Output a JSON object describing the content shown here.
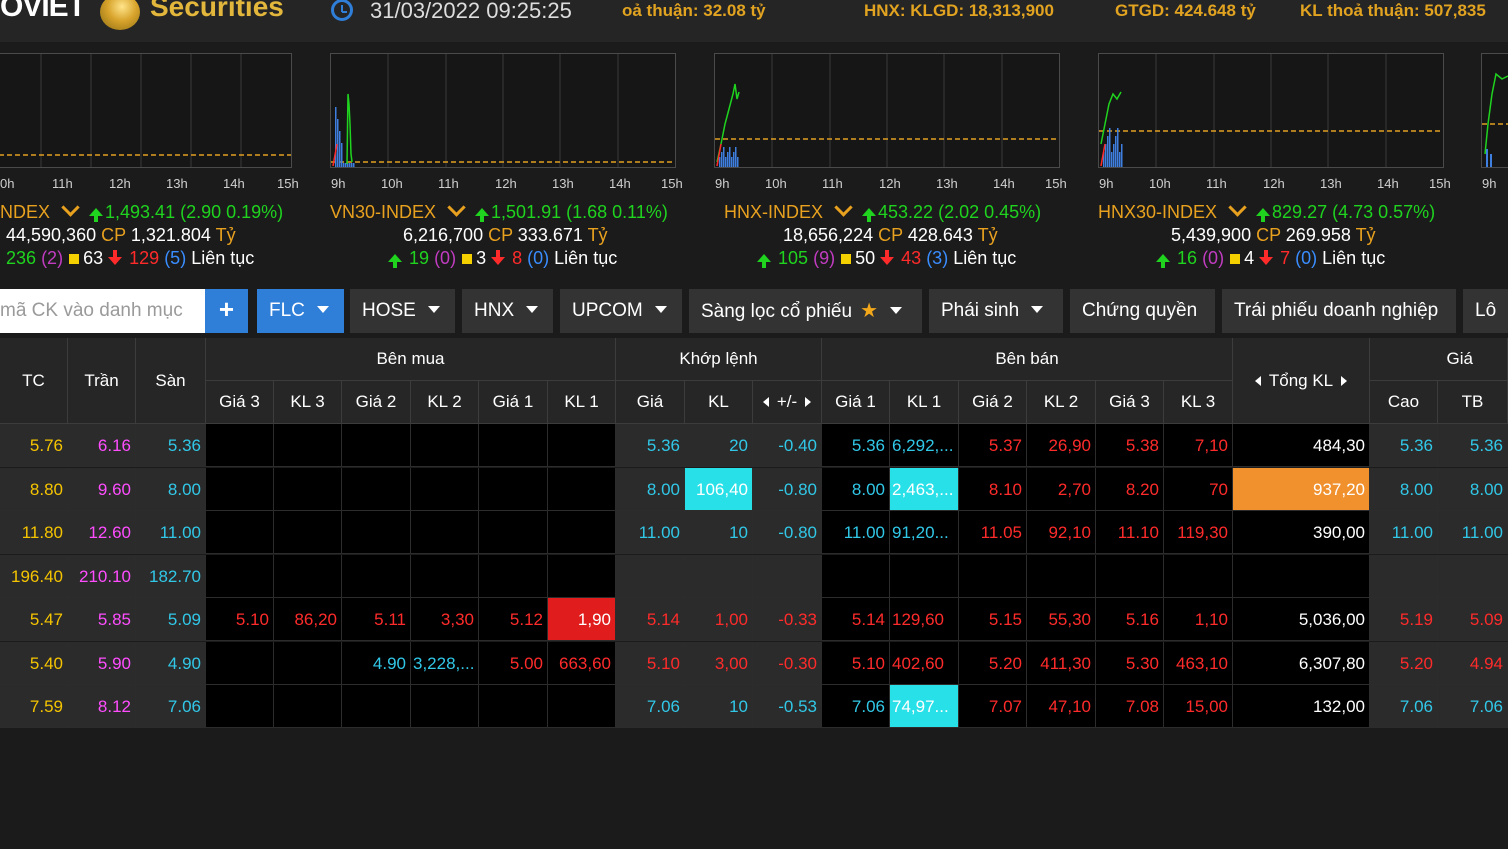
{
  "header": {
    "logo_text": "OVIET",
    "logo_sub": "Securities",
    "datetime": "31/03/2022 09:25:25",
    "tickers": [
      {
        "label": "oả thuận:",
        "value": "32.08 tỷ"
      },
      {
        "label": "HNX: KLGD:",
        "value": "18,313,900"
      },
      {
        "label": "GTGD:",
        "value": "424.648 tỷ"
      },
      {
        "label": "KL thoả thuận:",
        "value": "507,835"
      }
    ]
  },
  "indices": [
    {
      "name": "NDEX",
      "value": "1,493.41 (2.90 0.19%)",
      "volume": "44,590,360",
      "cp_label": "CP",
      "amount": "1,321.804",
      "ty": "Tỷ",
      "up": "236",
      "up_ceil": "(2)",
      "ref": "63",
      "down": "129",
      "down_floor": "(5)",
      "session": "Liên tục",
      "hours": [
        "0h",
        "11h",
        "12h",
        "13h",
        "14h",
        "15h"
      ]
    },
    {
      "name": "VN30-INDEX",
      "value": "1,501.91 (1.68 0.11%)",
      "volume": "6,216,700",
      "cp_label": "CP",
      "amount": "333.671",
      "ty": "Tỷ",
      "up": "19",
      "up_ceil": "(0)",
      "ref": "3",
      "down": "8",
      "down_floor": "(0)",
      "session": "Liên tục",
      "hours": [
        "9h",
        "10h",
        "11h",
        "12h",
        "13h",
        "14h",
        "15h"
      ]
    },
    {
      "name": "HNX-INDEX",
      "value": "453.22 (2.02 0.45%)",
      "volume": "18,656,224",
      "cp_label": "CP",
      "amount": "428.643",
      "ty": "Tỷ",
      "up": "105",
      "up_ceil": "(9)",
      "ref": "50",
      "down": "43",
      "down_floor": "(3)",
      "session": "Liên tục",
      "hours": [
        "9h",
        "10h",
        "11h",
        "12h",
        "13h",
        "14h",
        "15h"
      ]
    },
    {
      "name": "HNX30-INDEX",
      "value": "829.27 (4.73 0.57%)",
      "volume": "5,439,900",
      "cp_label": "CP",
      "amount": "269.958",
      "ty": "Tỷ",
      "up": "16",
      "up_ceil": "(0)",
      "ref": "4",
      "down": "7",
      "down_floor": "(0)",
      "session": "Liên tục",
      "hours": [
        "9h",
        "10h",
        "11h",
        "12h",
        "13h",
        "14h",
        "15h"
      ]
    }
  ],
  "fifth_chart_hour": "9h",
  "filters": {
    "search_placeholder": "mã CK vào danh mục",
    "add_label": "+",
    "buttons": [
      "FLC",
      "HOSE",
      "HNX",
      "UPCOM",
      "Sàng lọc cổ phiếu",
      "Phái sinh",
      "Chứng quyền",
      "Trái phiếu doanh nghiệp",
      "Lô"
    ]
  },
  "table": {
    "headers": {
      "tc": "TC",
      "tran": "Trần",
      "san": "Sàn",
      "ben_mua": "Bên mua",
      "khop_lenh": "Khớp lệnh",
      "ben_ban": "Bên bán",
      "tong_kl": "Tổng KL",
      "gia": "Giá",
      "buy_cols": [
        "Giá 3",
        "KL 3",
        "Giá 2",
        "KL 2",
        "Giá 1",
        "KL 1"
      ],
      "match_cols": [
        "Giá",
        "KL",
        "+/-"
      ],
      "sell_cols": [
        "Giá 1",
        "KL 1",
        "Giá 2",
        "KL 2",
        "Giá 3",
        "KL 3"
      ],
      "price_cols": [
        "Cao",
        "TB"
      ]
    },
    "rows": [
      {
        "tc": "5.76",
        "tran": "6.16",
        "san": "5.36",
        "b3p": "",
        "b3v": "",
        "b2p": "",
        "b2v": "",
        "b1p": "",
        "b1v": "",
        "mp": "5.36",
        "mv": "20",
        "mc": "-0.40",
        "s1p": "5.36",
        "s1v": "6,292,...",
        "s2p": "5.37",
        "s2v": "26,90",
        "s3p": "5.38",
        "s3v": "7,10",
        "tot": "484,30",
        "hi": "5.36",
        "avg": "5.36"
      },
      {
        "tc": "8.80",
        "tran": "9.60",
        "san": "8.00",
        "b3p": "",
        "b3v": "",
        "b2p": "",
        "b2v": "",
        "b1p": "",
        "b1v": "",
        "mp": "8.00",
        "mv": "106,40",
        "mc": "-0.80",
        "s1p": "8.00",
        "s1v": "2,463,...",
        "s2p": "8.10",
        "s2v": "2,70",
        "s3p": "8.20",
        "s3v": "70",
        "tot": "937,20",
        "hi": "8.00",
        "avg": "8.00"
      },
      {
        "tc": "11.80",
        "tran": "12.60",
        "san": "11.00",
        "b3p": "",
        "b3v": "",
        "b2p": "",
        "b2v": "",
        "b1p": "",
        "b1v": "",
        "mp": "11.00",
        "mv": "10",
        "mc": "-0.80",
        "s1p": "11.00",
        "s1v": "91,20...",
        "s2p": "11.05",
        "s2v": "92,10",
        "s3p": "11.10",
        "s3v": "119,30",
        "tot": "390,00",
        "hi": "11.00",
        "avg": "11.00"
      },
      {
        "tc": "196.40",
        "tran": "210.10",
        "san": "182.70",
        "b3p": "",
        "b3v": "",
        "b2p": "",
        "b2v": "",
        "b1p": "",
        "b1v": "",
        "mp": "",
        "mv": "",
        "mc": "",
        "s1p": "",
        "s1v": "",
        "s2p": "",
        "s2v": "",
        "s3p": "",
        "s3v": "",
        "tot": "",
        "hi": "",
        "avg": ""
      },
      {
        "tc": "5.47",
        "tran": "5.85",
        "san": "5.09",
        "b3p": "5.10",
        "b3v": "86,20",
        "b2p": "5.11",
        "b2v": "3,30",
        "b1p": "5.12",
        "b1v": "1,90",
        "mp": "5.14",
        "mv": "1,00",
        "mc": "-0.33",
        "s1p": "5.14",
        "s1v": "129,60",
        "s2p": "5.15",
        "s2v": "55,30",
        "s3p": "5.16",
        "s3v": "1,10",
        "tot": "5,036,00",
        "hi": "5.19",
        "avg": "5.09"
      },
      {
        "tc": "5.40",
        "tran": "5.90",
        "san": "4.90",
        "b3p": "",
        "b3v": "",
        "b2p": "4.90",
        "b2v": "3,228,...",
        "b1p": "5.00",
        "b1v": "663,60",
        "mp": "5.10",
        "mv": "3,00",
        "mc": "-0.30",
        "s1p": "5.10",
        "s1v": "402,60",
        "s2p": "5.20",
        "s2v": "411,30",
        "s3p": "5.30",
        "s3v": "463,10",
        "tot": "6,307,80",
        "hi": "5.20",
        "avg": "4.94"
      },
      {
        "tc": "7.59",
        "tran": "8.12",
        "san": "7.06",
        "b3p": "",
        "b3v": "",
        "b2p": "",
        "b2v": "",
        "b1p": "",
        "b1v": "",
        "mp": "7.06",
        "mv": "10",
        "mc": "-0.53",
        "s1p": "7.06",
        "s1v": "74,97...",
        "s2p": "7.07",
        "s2v": "47,10",
        "s3p": "7.08",
        "s3v": "15,00",
        "tot": "132,00",
        "hi": "7.06",
        "avg": "7.06"
      }
    ]
  },
  "colors": {
    "ref": "#f5c400",
    "ceiling": "#ff4dff",
    "floor": "#31c8e8",
    "down": "#ff2b2b",
    "up": "#1fd31f",
    "accent": "#2f7ed8"
  }
}
